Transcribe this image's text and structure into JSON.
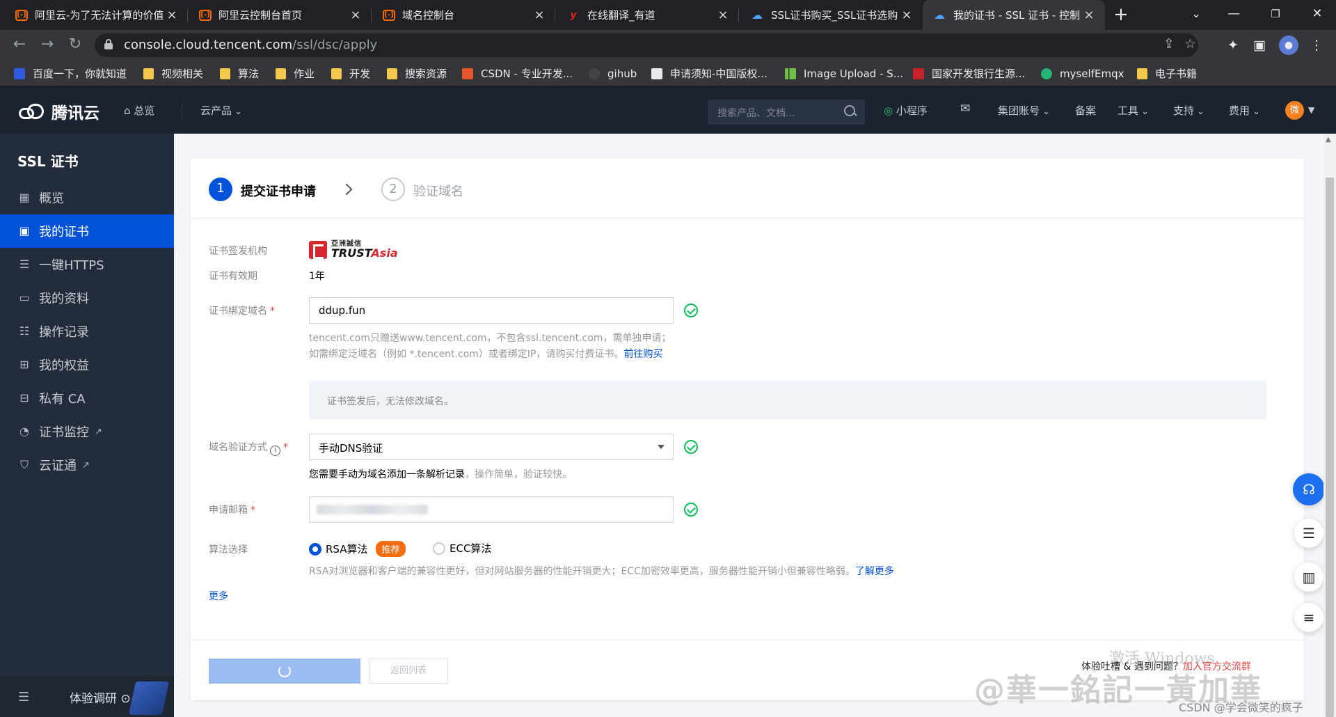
{
  "browser": {
    "tabs": [
      {
        "title": "阿里云-为了无法计算的价值",
        "icon": "aliyun-icon"
      },
      {
        "title": "阿里云控制台首页",
        "icon": "aliyun-icon"
      },
      {
        "title": "域名控制台",
        "icon": "aliyun-icon"
      },
      {
        "title": "在线翻译_有道",
        "icon": "youdao-icon"
      },
      {
        "title": "SSL证书购买_SSL证书选购",
        "icon": "tencent-cloud-icon"
      },
      {
        "title": "我的证书 - SSL 证书 - 控制",
        "icon": "tencent-cloud-icon",
        "active": true
      }
    ],
    "url_host": "console.cloud.tencent.com",
    "url_path": "/ssl/dsc/apply",
    "bookmarks": [
      {
        "label": "百度一下，你就知道",
        "icon": "baidu-icon"
      },
      {
        "label": "视频相关",
        "icon": "folder-icon"
      },
      {
        "label": "算法",
        "icon": "folder-icon"
      },
      {
        "label": "作业",
        "icon": "folder-icon"
      },
      {
        "label": "开发",
        "icon": "folder-icon"
      },
      {
        "label": "搜索资源",
        "icon": "folder-icon"
      },
      {
        "label": "CSDN - 专业开发...",
        "icon": "csdn-icon"
      },
      {
        "label": "gihub",
        "icon": "github-icon"
      },
      {
        "label": "申请须知-中国版权...",
        "icon": "page-icon"
      },
      {
        "label": "Image Upload - S...",
        "icon": "bar-chart-icon"
      },
      {
        "label": "国家开发银行生源...",
        "icon": "bank-icon"
      },
      {
        "label": "myselfEmqx",
        "icon": "emqx-icon"
      },
      {
        "label": "电子书籍",
        "icon": "folder-icon"
      }
    ]
  },
  "topnav": {
    "brand": "腾讯云",
    "overview": "总览",
    "products": "云产品",
    "search_placeholder": "搜索产品、文档...",
    "miniprogram": "小程序",
    "group_account": "集团账号",
    "filing": "备案",
    "tools": "工具",
    "support": "支持",
    "billing": "费用",
    "avatar": "微"
  },
  "sidebar": {
    "title": "SSL 证书",
    "items": [
      {
        "label": "概览",
        "icon": "grid-icon"
      },
      {
        "label": "我的证书",
        "icon": "certificate-icon",
        "active": true
      },
      {
        "label": "一键HTTPS",
        "icon": "sliders-icon"
      },
      {
        "label": "我的资料",
        "icon": "folder-icon"
      },
      {
        "label": "操作记录",
        "icon": "list-icon"
      },
      {
        "label": "我的权益",
        "icon": "gift-icon"
      },
      {
        "label": "私有 CA",
        "icon": "ca-icon"
      },
      {
        "label": "证书监控",
        "icon": "monitor-icon",
        "external": true
      },
      {
        "label": "云证通",
        "icon": "shield-icon",
        "external": true
      }
    ],
    "feedback": "体验调研"
  },
  "steps": [
    {
      "num": "1",
      "label": "提交证书申请",
      "active": true
    },
    {
      "num": "2",
      "label": "验证域名",
      "active": false
    }
  ],
  "form": {
    "issuer_label": "证书签发机构",
    "issuer_logo_cn": "亞洲誠信",
    "issuer_logo_en_a": "TRUST",
    "issuer_logo_en_b": "Asia",
    "validity_label": "证书有效期",
    "validity_value": "1年",
    "domain_label": "证书绑定域名",
    "domain_value": "ddup.fun",
    "domain_hint_1": "tencent.com只赠送www.tencent.com，不包含ssl.tencent.com，需单独申请；",
    "domain_hint_2": "如需绑定泛域名（例如 *.tencent.com）或者绑定IP，请购买付费证书。",
    "domain_hint_link": "前往购买",
    "notice": "证书签发后，无法修改域名。",
    "verify_label": "域名验证方式",
    "verify_value": "手动DNS验证",
    "verify_hint_a": "您需要手动为域名添加一条解析记录",
    "verify_hint_b": "，操作简单，验证较快。",
    "email_label": "申请邮箱",
    "algo_label": "算法选择",
    "algo_rsa": "RSA算法",
    "algo_badge": "推荐",
    "algo_ecc": "ECC算法",
    "algo_hint": "RSA对浏览器和客户端的兼容性更好，但对网站服务器的性能开销更大；ECC加密效率更高，服务器性能开销小但兼容性略弱。",
    "algo_hint_link": "了解更多",
    "more": "更多"
  },
  "footer": {
    "back_button": "返回列表"
  },
  "overlay": {
    "promo_a": "体验吐槽 & 遇到问题？",
    "promo_b": "加入官方交流群",
    "activate": "激活 Windows",
    "watermark_big": "@華一銘記一黃加華",
    "watermark_small": "CSDN @学会微笑的疯子"
  }
}
